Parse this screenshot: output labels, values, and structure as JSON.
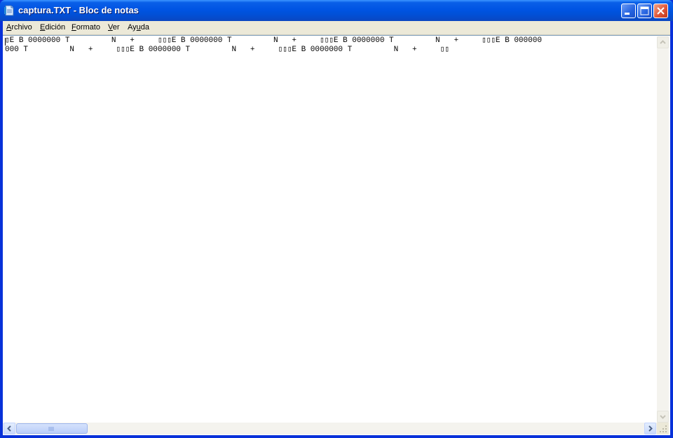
{
  "window": {
    "title": "captura.TXT - Bloc de notas",
    "colors": {
      "titlebar": "#0054e3",
      "close": "#e0583a",
      "client": "#ece9d8"
    }
  },
  "menu": {
    "items": [
      {
        "label_ul": "A",
        "label_rest": "rchivo"
      },
      {
        "label_ul": "E",
        "label_rest": "dición"
      },
      {
        "label_ul": "F",
        "label_rest": "ormato"
      },
      {
        "label_ul": "V",
        "label_rest": "er"
      },
      {
        "label_pre": "Ay",
        "label_ul": "u",
        "label_rest": "da"
      }
    ]
  },
  "editor": {
    "line1": "▯E B 0000000 T         N   +     ▯▯▯E B 0000000 T         N   +     ▯▯▯E B 0000000 T         N   +     ▯▯▯E B 000000",
    "line2": "000 T         N   +     ▯▯▯E B 0000000 T         N   +     ▯▯▯E B 0000000 T         N   +     ▯▯"
  },
  "icons": {
    "app": "notepad-icon",
    "minimize": "minimize-icon",
    "maximize": "maximize-icon",
    "close": "close-icon",
    "scroll_up": "arrow-up-icon",
    "scroll_down": "arrow-down-icon",
    "scroll_left": "arrow-left-icon",
    "scroll_right": "arrow-right-icon",
    "grip": "resize-grip-icon"
  }
}
